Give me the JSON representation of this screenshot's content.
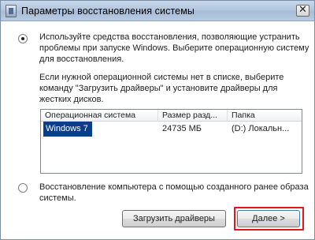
{
  "window": {
    "title": "Параметры восстановления системы",
    "close_glyph": "✕",
    "icon": "system-recovery-icon"
  },
  "options": [
    {
      "selected": true,
      "text": "Используйте средства восстановления, позволяющие устранить проблемы при запуске Windows. Выберите операционную систему для восстановления."
    },
    {
      "selected": false,
      "text": "Восстановление компьютера с помощью созданного ранее образа системы."
    }
  ],
  "hint": "Если нужной операционной системы нет в списке, выберите команду \"Загрузить драйверы\" и установите драйверы для жестких дисков.",
  "os_list": {
    "columns": [
      "Операционная система",
      "Размер разд...",
      "Папка"
    ],
    "rows": [
      {
        "os": "Windows 7",
        "size": "24735 МБ",
        "folder": "(D:) Локальн..."
      }
    ]
  },
  "buttons": {
    "load_drivers": "Загрузить драйверы",
    "next": "Далее >"
  },
  "colors": {
    "selection": "#0b3e8a",
    "highlight_frame": "#e8141b"
  }
}
